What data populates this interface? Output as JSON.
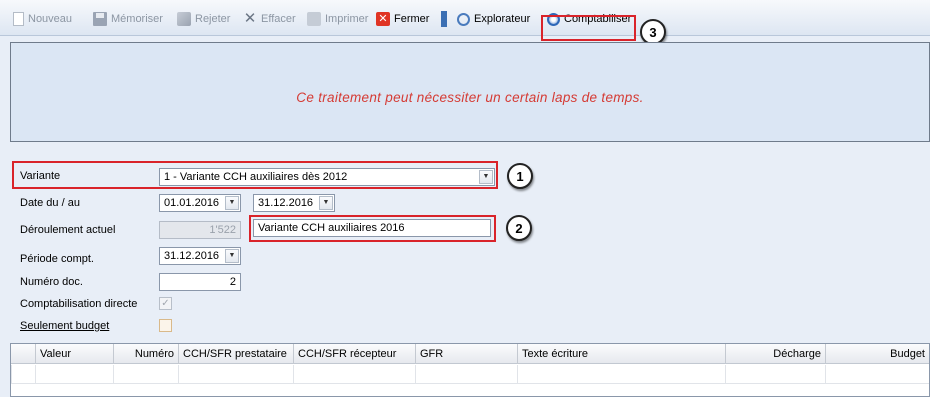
{
  "toolbar": {
    "items": [
      {
        "label": "Nouveau",
        "icon": "new-document-icon",
        "enabled": false
      },
      {
        "label": "Mémoriser",
        "icon": "save-icon",
        "enabled": false
      },
      {
        "label": "Rejeter",
        "icon": "reject-icon",
        "enabled": false
      },
      {
        "label": "Effacer",
        "icon": "delete-icon",
        "enabled": false
      },
      {
        "label": "Imprimer",
        "icon": "print-icon",
        "enabled": false
      },
      {
        "label": "Fermer",
        "icon": "close-icon",
        "enabled": true
      },
      {
        "label": "Explorateur",
        "icon": "explorer-icon",
        "enabled": true
      },
      {
        "label": "Comptabiliser",
        "icon": "post-icon",
        "enabled": true
      }
    ]
  },
  "info": {
    "message": "Ce traitement peut nécessiter un certain laps de temps."
  },
  "form": {
    "variante": {
      "label": "Variante",
      "value": "1 - Variante CCH auxiliaires dès 2012"
    },
    "dates": {
      "label": "Date du / au",
      "from": "01.01.2016",
      "to": "31.12.2016"
    },
    "deroulement": {
      "label": "Déroulement actuel",
      "number": "1'522",
      "text": "Variante CCH auxiliaires 2016"
    },
    "periode": {
      "label": "Période compt.",
      "value": "31.12.2016"
    },
    "numero": {
      "label": "Numéro doc.",
      "value": "2"
    },
    "directe": {
      "label": "Comptabilisation directe",
      "checked": true
    },
    "budget": {
      "label": "Seulement budget",
      "checked": false
    }
  },
  "grid": {
    "columns": [
      "Valeur",
      "Numéro",
      "CCH/SFR prestataire",
      "CCH/SFR récepteur",
      "GFR",
      "Texte écriture",
      "Décharge",
      "Budget"
    ]
  },
  "callouts": [
    "1",
    "2",
    "3"
  ],
  "colors": {
    "highlight": "#d9232a",
    "message": "#d53b34",
    "panel": "#dbe6f4",
    "background": "#e8eef7"
  }
}
